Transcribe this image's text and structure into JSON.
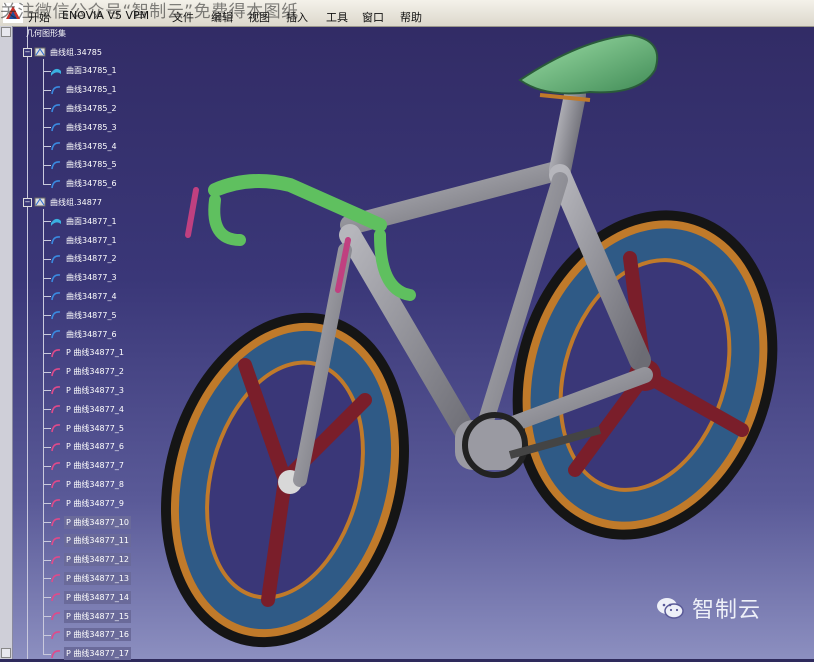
{
  "overlay": {
    "text": "关注微信公众号“智制云”免费得本图纸"
  },
  "menubar": {
    "items": [
      "开始",
      "ENOVIA V5 VPM",
      "文件",
      "编辑",
      "视图",
      "插入",
      "工具",
      "窗口",
      "帮助"
    ]
  },
  "tree": {
    "root_label": "几何图形集",
    "groups": [
      {
        "label": "曲线组.34785",
        "items": [
          "曲面34785_1",
          "曲线34785_1",
          "曲线34785_2",
          "曲线34785_3",
          "曲线34785_4",
          "曲线34785_5",
          "曲线34785_6"
        ]
      },
      {
        "label": "曲线组.34877",
        "items": [
          "曲面34877_1",
          "曲线34877_1",
          "曲线34877_2",
          "曲线34877_3",
          "曲线34877_4",
          "曲线34877_5",
          "曲线34877_6",
          "P 曲线34877_1",
          "P 曲线34877_2",
          "P 曲线34877_3",
          "P 曲线34877_4",
          "P 曲线34877_5",
          "P 曲线34877_6",
          "P 曲线34877_7",
          "P 曲线34877_8",
          "P 曲线34877_9",
          "P 曲线34877_10",
          "P 曲线34877_11",
          "P 曲线34877_12",
          "P 曲线34877_13",
          "P 曲线34877_14",
          "P 曲线34877_15",
          "P 曲线34877_16",
          "P 曲线34877_17"
        ]
      }
    ]
  },
  "watermark": {
    "text": "智制云"
  },
  "colors": {
    "background": "#3a3778",
    "frame": "#8a8a90",
    "wheel_blue": "#2f5a86",
    "rim_orange": "#c07a2a",
    "spoke_red": "#7a1e2a",
    "bar_green": "#5fc05f",
    "saddle": "#6fb080"
  }
}
